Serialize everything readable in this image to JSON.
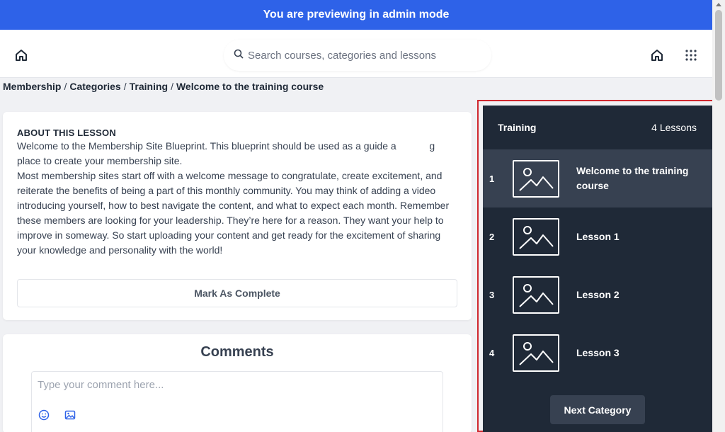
{
  "banner": {
    "text": "You are previewing in admin mode"
  },
  "header": {
    "home_icon": "home-icon",
    "search_icon": "search-icon",
    "search_placeholder": "Search courses, categories and lessons",
    "apps_icon": "grid-icon"
  },
  "breadcrumb": [
    "Membership",
    "Categories",
    "Training",
    "Welcome to the training course"
  ],
  "breadcrumb_sep": "/",
  "about": {
    "title": "ABOUT THIS LESSON",
    "paragraphs": [
      "Welcome to the Membership Site Blueprint. This blueprint should be used as a guide a            g place to create your membership site.",
      "Most membership sites start off with a welcome message to congratulate, create excitement, and reiterate the benefits of being a part of this monthly community. You may think of adding a video introducing yourself, how to best navigate the content, and what to expect each month. Remember these members are looking for your leadership. They’re here for a reason. They want your help to improve in someway. So start uploading your content and get ready for the excitement of sharing your knowledge and personality with the world!"
    ],
    "complete_label": "Mark As Complete"
  },
  "comments": {
    "title": "Comments",
    "placeholder": "Type your comment here...",
    "emoji_icon": "smiley-icon",
    "image_icon": "image-icon"
  },
  "sidebar": {
    "category": "Training",
    "lesson_count": "4 Lessons",
    "lessons": [
      {
        "number": "1",
        "title": "Welcome to the training course",
        "active": true
      },
      {
        "number": "2",
        "title": "Lesson 1",
        "active": false
      },
      {
        "number": "3",
        "title": "Lesson 2",
        "active": false
      },
      {
        "number": "4",
        "title": "Lesson 3",
        "active": false
      }
    ],
    "next_label": "Next Category"
  },
  "colors": {
    "banner": "#2e62e8",
    "sidebar_bg": "#1f2937",
    "sidebar_active": "#374151",
    "highlight_frame": "#d0282f",
    "accent_icon": "#2e62e8"
  }
}
